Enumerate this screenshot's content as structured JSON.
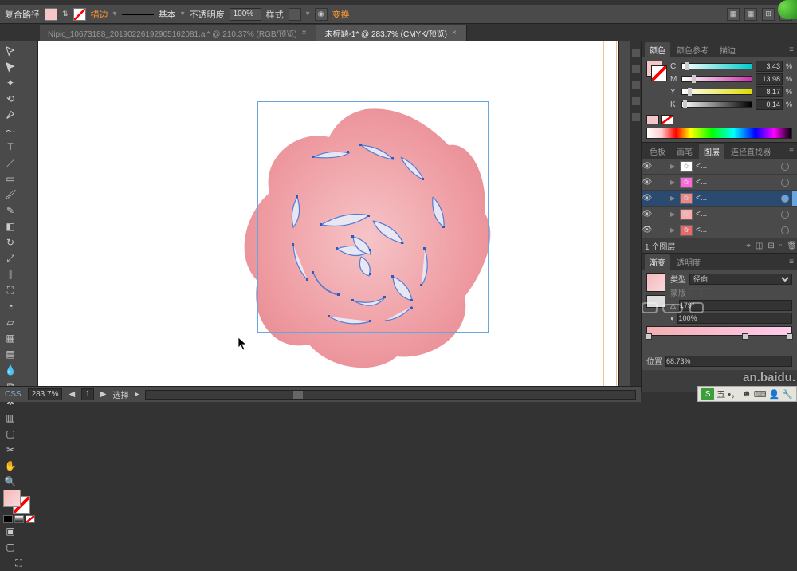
{
  "app": {
    "title": "复合路径"
  },
  "control_bar": {
    "stroke_link": "描边",
    "stroke_weight_label": "基本",
    "opacity_label": "不透明度",
    "opacity_value": "100%",
    "style_label": "样式",
    "transform_link": "变换",
    "align_icons": [
      "▦",
      "▦",
      "⊞",
      "⊞"
    ]
  },
  "tabs": [
    {
      "label": "Nipic_10673188_20190226192905162081.ai* @ 210.37% (RGB/预览)",
      "active": false
    },
    {
      "label": "未标题-1* @ 283.7% (CMYK/预览)",
      "active": true
    }
  ],
  "color_panel": {
    "tabs": [
      "颜色",
      "颜色参考",
      "描边"
    ],
    "channels": [
      {
        "lbl": "C",
        "val": "3.43",
        "grad": "linear-gradient(to right,#fff,#0cc)",
        "pos": "4%"
      },
      {
        "lbl": "M",
        "val": "13.98",
        "grad": "linear-gradient(to right,#fff,#c3a)",
        "pos": "14%"
      },
      {
        "lbl": "Y",
        "val": "8.17",
        "grad": "linear-gradient(to right,#fff,#dd0)",
        "pos": "8%"
      },
      {
        "lbl": "K",
        "val": "0.14",
        "grad": "linear-gradient(to right,#fff,#000)",
        "pos": "1%"
      }
    ]
  },
  "layers_panel": {
    "tabs": [
      "色板",
      "画笔",
      "图层",
      "连径直找器"
    ],
    "rows": [
      {
        "thumb_bg": "#fff",
        "name": "<..."
      },
      {
        "thumb_bg": "#f6d",
        "name": "<..."
      },
      {
        "thumb_bg": "#e88",
        "name": "<...",
        "selected": true
      },
      {
        "thumb_bg": "#faa",
        "name": "<..."
      },
      {
        "thumb_bg": "#e66",
        "name": "<..."
      }
    ],
    "footer_text": "1 个图层"
  },
  "gradient_panel": {
    "tabs": [
      "渐变",
      "透明度"
    ],
    "type_label": "类型",
    "type_value": "径向",
    "mask_label": "蒙版",
    "angle_value": "179°",
    "opacity_value": "100%",
    "location_label": "位置",
    "location_value": "68.73%"
  },
  "status": {
    "zoom": "283.7%",
    "artboard_nav": "1",
    "tool_label": "选择"
  },
  "watermark": "an.baidu.",
  "ime": {
    "label": "五"
  }
}
